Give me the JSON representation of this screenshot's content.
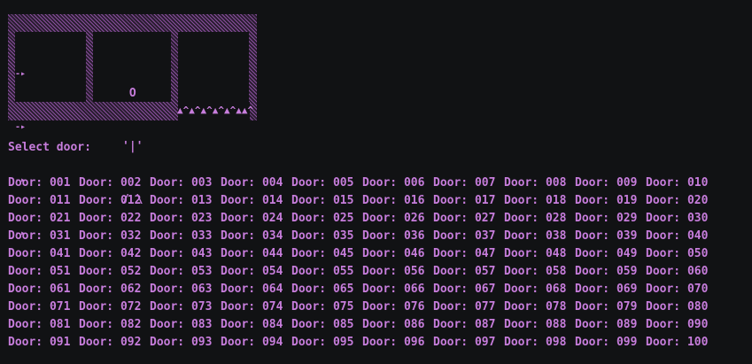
{
  "window": {
    "accent": "#c77ddc",
    "background": "#111214"
  },
  "art": {
    "arrows": [
      "-▸",
      "-▸",
      "-▸",
      "-▸"
    ],
    "figure": [
      " O",
      "'|'",
      "/ \\"
    ],
    "spikes": "▲^▲^▲^▲^▲^▲▲^"
  },
  "prompt": {
    "text": "Select door:"
  },
  "doors": {
    "prefix": "Door:",
    "rows": [
      [
        "001",
        "002",
        "003",
        "004",
        "005",
        "006",
        "007",
        "008",
        "009",
        "010"
      ],
      [
        "011",
        "012",
        "013",
        "014",
        "015",
        "016",
        "017",
        "018",
        "019",
        "020"
      ],
      [
        "021",
        "022",
        "023",
        "024",
        "025",
        "026",
        "027",
        "028",
        "029",
        "030"
      ],
      [
        "031",
        "032",
        "033",
        "034",
        "035",
        "036",
        "037",
        "038",
        "039",
        "040"
      ],
      [
        "041",
        "042",
        "043",
        "044",
        "045",
        "046",
        "047",
        "048",
        "049",
        "050"
      ],
      [
        "051",
        "052",
        "053",
        "054",
        "055",
        "056",
        "057",
        "058",
        "059",
        "060"
      ],
      [
        "061",
        "062",
        "063",
        "064",
        "065",
        "066",
        "067",
        "068",
        "069",
        "070"
      ],
      [
        "071",
        "072",
        "073",
        "074",
        "075",
        "076",
        "077",
        "078",
        "079",
        "080"
      ],
      [
        "081",
        "082",
        "083",
        "084",
        "085",
        "086",
        "087",
        "088",
        "089",
        "090"
      ],
      [
        "091",
        "092",
        "093",
        "094",
        "095",
        "096",
        "097",
        "098",
        "099",
        "100"
      ]
    ]
  }
}
